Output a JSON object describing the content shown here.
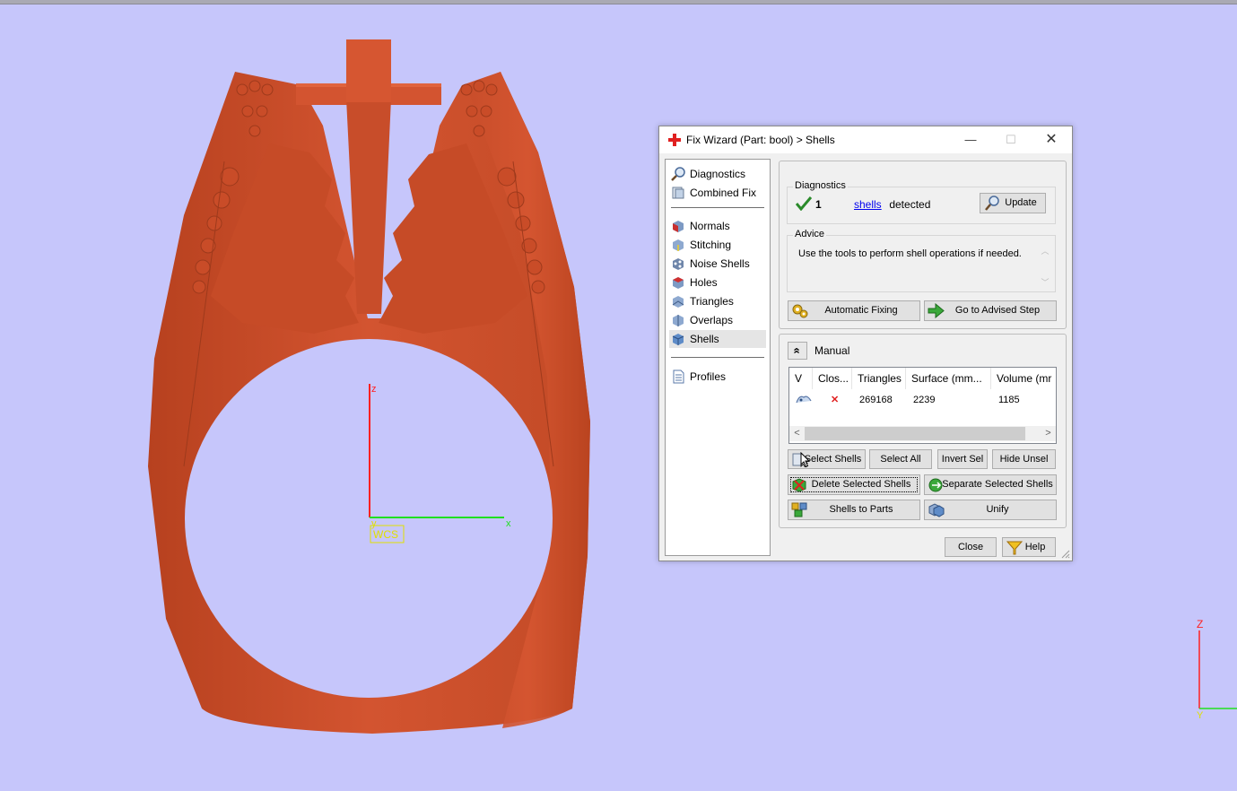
{
  "viewport": {
    "wcs_label": "WCS",
    "main_axes": {
      "x": "x",
      "y": "y",
      "z": "z"
    },
    "corner_axes": {
      "z": "Z",
      "y": "Y"
    },
    "model_color": "#d04f2b",
    "background_color": "#c6c6fb"
  },
  "dialog": {
    "title": "Fix Wizard (Part: bool) > Shells",
    "title_icon": "red-cross-icon",
    "window_buttons": {
      "minimize": "—",
      "maximize": "☐",
      "close": "✕"
    },
    "nav": {
      "group1": [
        {
          "label": "Diagnostics",
          "icon": "magnifier-icon"
        },
        {
          "label": "Combined Fix",
          "icon": "combined-fix-icon"
        }
      ],
      "group2": [
        {
          "label": "Normals",
          "icon": "normals-cube-icon"
        },
        {
          "label": "Stitching",
          "icon": "stitching-cube-icon"
        },
        {
          "label": "Noise Shells",
          "icon": "noise-shells-icon"
        },
        {
          "label": "Holes",
          "icon": "holes-cube-icon"
        },
        {
          "label": "Triangles",
          "icon": "triangles-cube-icon"
        },
        {
          "label": "Overlaps",
          "icon": "overlaps-cube-icon"
        },
        {
          "label": "Shells",
          "icon": "shells-cube-icon",
          "selected": true
        }
      ],
      "group3": [
        {
          "label": "Profiles",
          "icon": "document-icon"
        }
      ]
    },
    "diagnostics": {
      "title": "Diagnostics",
      "count": "1",
      "link_text": "shells",
      "suffix": " detected",
      "update_label": "Update"
    },
    "advice": {
      "title": "Advice",
      "text": "Use the tools to perform shell operations if needed."
    },
    "auto_fix_label": "Automatic Fixing",
    "advised_step_label": "Go to Advised Step",
    "manual": {
      "title": "Manual",
      "expand_glyph": "«",
      "columns": [
        "V",
        "Clos...",
        "Triangles",
        "Surface (mm...",
        "Volume (mr"
      ],
      "rows": [
        {
          "visible_icon": "shell-visible-icon",
          "closed": "✕",
          "triangles": "269168",
          "surface": "2239",
          "volume": "1185"
        }
      ],
      "scroll_left": "<",
      "scroll_right": ">"
    },
    "buttons": {
      "select_shells": "Select Shells",
      "select_all": "Select All",
      "invert_sel": "Invert Sel",
      "hide_unsel": "Hide Unsel",
      "delete_selected": "Delete Selected Shells",
      "separate_selected": "Separate Selected Shells",
      "shells_to_parts": "Shells to Parts",
      "unify": "Unify",
      "close": "Close",
      "help": "Help"
    }
  }
}
